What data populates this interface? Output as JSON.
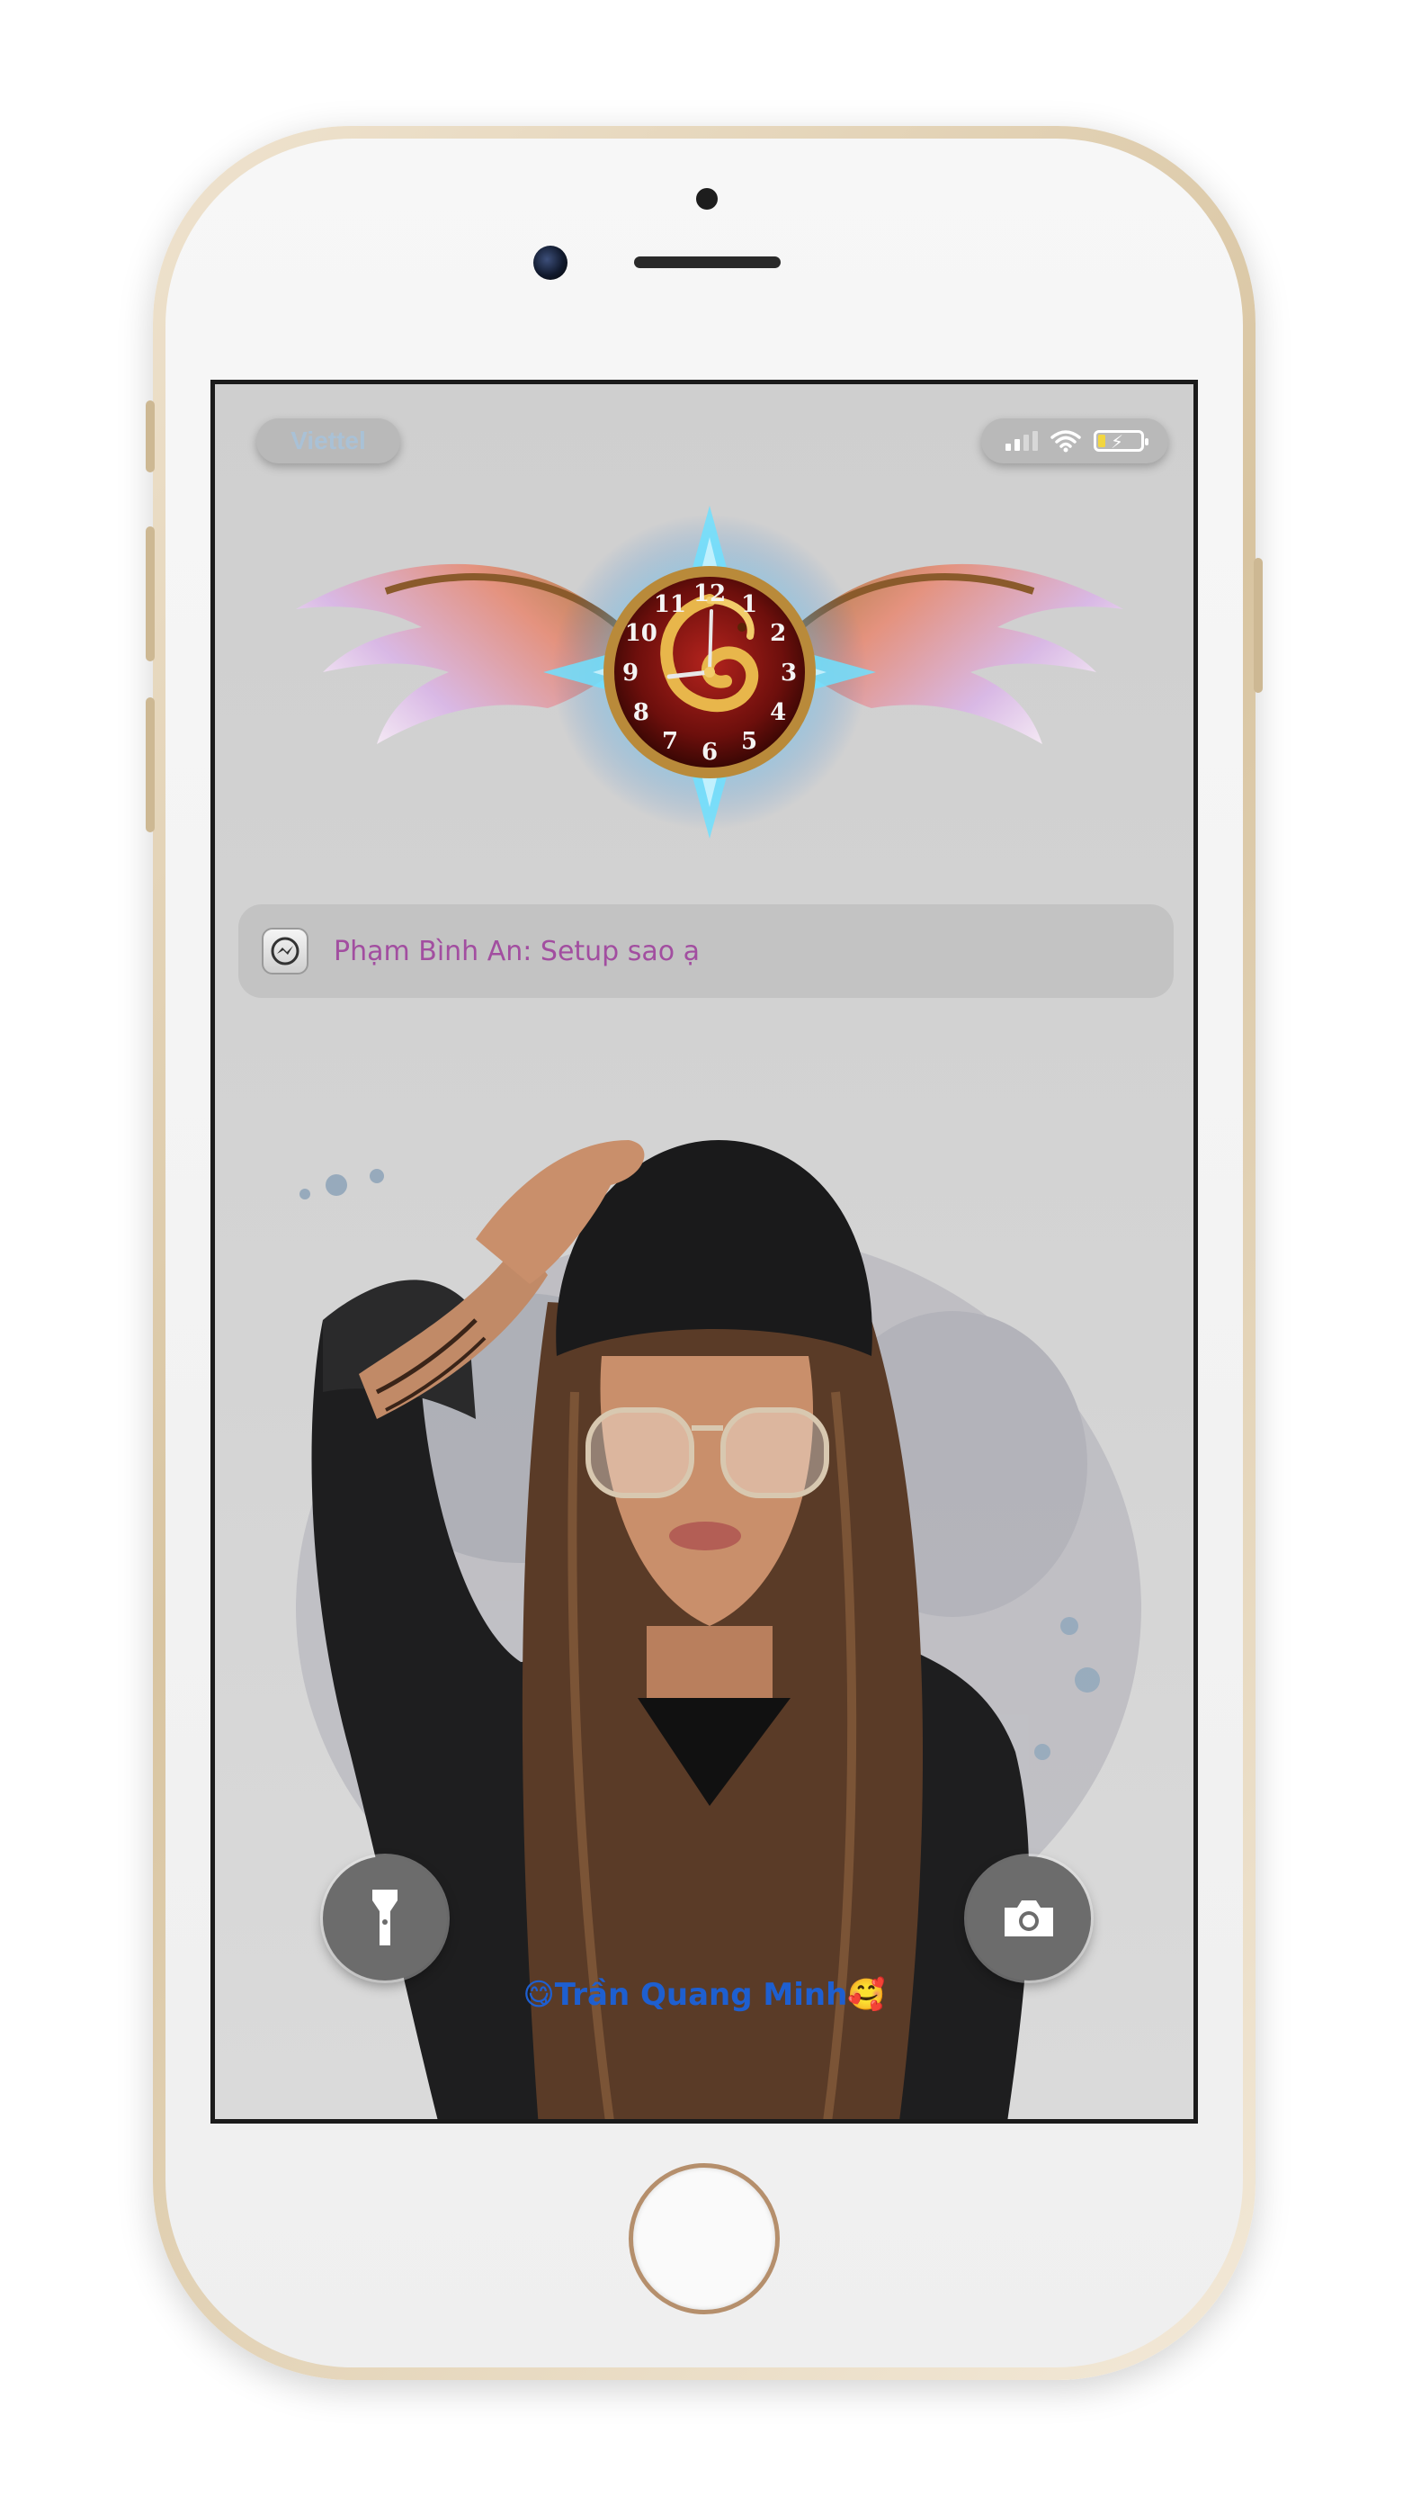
{
  "status_bar": {
    "carrier": "Viettel",
    "signal_icon": "signal-bars-icon",
    "wifi_icon": "wifi-icon",
    "battery_icon": "battery-charging-icon",
    "battery_level": 0.15
  },
  "clock_widget": {
    "numerals": [
      "12",
      "1",
      "2",
      "3",
      "4",
      "5",
      "6",
      "7",
      "8",
      "9",
      "10",
      "11"
    ]
  },
  "notification": {
    "app_icon": "messenger-icon",
    "text": "Phạm Bình An: Setup sao ạ"
  },
  "controls": {
    "flashlight_icon": "flashlight-icon",
    "camera_icon": "camera-icon"
  },
  "owner_label": "😋Trần Quang Minh🥰",
  "colors": {
    "screen_bg": "#d0d0d0",
    "notification_text": "#a24ea0",
    "owner_text": "#1e5fd0",
    "carrier_text": "#a9c1d6"
  }
}
